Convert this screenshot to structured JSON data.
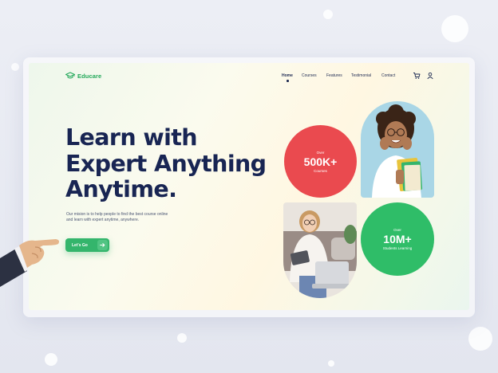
{
  "brand": {
    "name": "Educare"
  },
  "nav": {
    "items": [
      {
        "label": "Home",
        "active": true
      },
      {
        "label": "Courses",
        "active": false
      },
      {
        "label": "Features",
        "active": false
      },
      {
        "label": "Testimonial",
        "active": false
      },
      {
        "label": "Contact",
        "active": false
      }
    ],
    "icons": [
      "cart-icon",
      "user-icon"
    ]
  },
  "hero": {
    "title_lines": [
      "Learn with",
      "Expert Anything",
      "Anytime."
    ],
    "description": "Our mision is to help people to find the best course online and learn with expert anytime, anywhere.",
    "cta_label": "Let's Go",
    "cta_icon": "arrow-right-icon"
  },
  "stats": [
    {
      "prefix": "Over",
      "value": "500K+",
      "label": "Courses",
      "color": "#ea4a4f"
    },
    {
      "prefix": "Over",
      "value": "10M+",
      "label": "Students Learning",
      "color": "#2fbd68"
    }
  ],
  "colors": {
    "brand_green": "#23a85a",
    "heading_navy": "#182553",
    "cta_green": "#34b56c",
    "stat_red": "#ea4a4f",
    "stat_green": "#2fbd68",
    "photo_bg_blue": "#a9d6e6",
    "photo_bg_beige": "#e9e4de"
  }
}
